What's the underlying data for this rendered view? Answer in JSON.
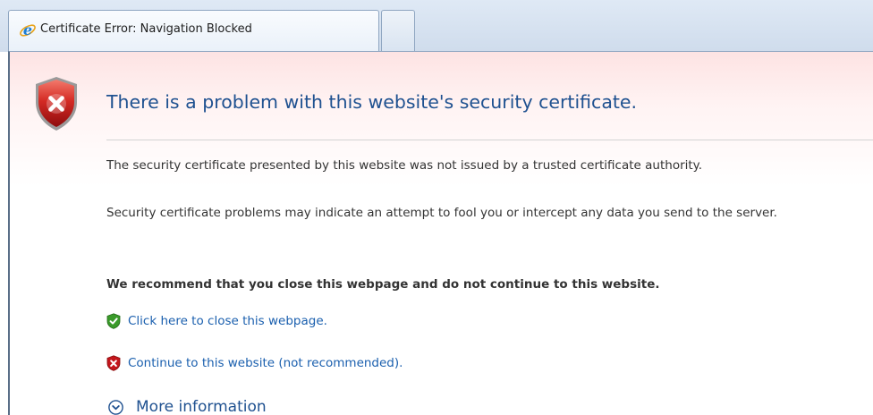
{
  "tabs": [
    {
      "title": "Certificate Error: Navigation Blocked",
      "icon": "ie-icon",
      "active": true
    },
    {
      "title": "",
      "icon": "new-tab",
      "active": false
    }
  ],
  "page": {
    "heading": "There is a problem with this website's security certificate.",
    "heading_icon": "error-shield-icon",
    "paragraphs": [
      "The security certificate presented by this website was not issued by a trusted certificate authority.",
      "Security certificate problems may indicate an attempt to fool you or intercept any data you send to the server."
    ],
    "recommendation": "We recommend that you close this webpage and do not continue to this website.",
    "links": {
      "close": {
        "label": "Click here to close this webpage.",
        "icon": "green-shield-check-icon"
      },
      "continue": {
        "label": "Continue to this website (not recommended).",
        "icon": "red-shield-x-icon"
      }
    },
    "more_info": {
      "label": "More information",
      "icon": "expand-circle-icon"
    }
  },
  "colors": {
    "heading": "#1f5190",
    "link": "#1a5fae",
    "body_text": "#333333",
    "error_red": "#c4161c",
    "safe_green": "#3a9a2a"
  }
}
